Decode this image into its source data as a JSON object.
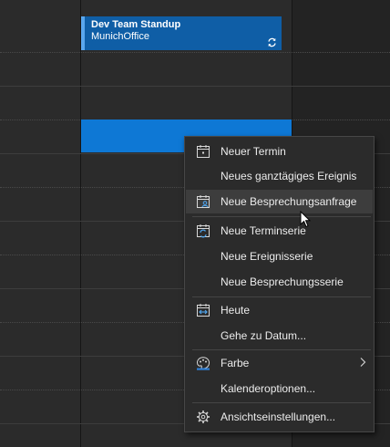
{
  "event": {
    "title": "Dev Team Standup",
    "location": "MunichOffice",
    "recurring_icon": "recurring-sync-icon",
    "color": "#0f5ea6"
  },
  "selection_color": "#0e78d5",
  "context_menu": {
    "items": [
      {
        "label": "Neuer Termin",
        "icon": "calendar-new-icon"
      },
      {
        "label": "Neues ganztägiges Ereignis",
        "icon": ""
      },
      {
        "label": "Neue Besprechungsanfrage",
        "icon": "meeting-request-icon"
      },
      {
        "label": "Neue Terminserie",
        "icon": "recurring-appointment-icon"
      },
      {
        "label": "Neue Ereignisserie",
        "icon": ""
      },
      {
        "label": "Neue Besprechungsserie",
        "icon": ""
      },
      {
        "label": "Heute",
        "icon": "today-icon"
      },
      {
        "label": "Gehe zu Datum...",
        "icon": ""
      },
      {
        "label": "Farbe",
        "icon": "color-palette-icon",
        "submenu": true
      },
      {
        "label": "Kalenderoptionen...",
        "icon": ""
      },
      {
        "label": "Ansichtseinstellungen...",
        "icon": "gear-icon"
      }
    ],
    "hovered_item": "Neue Besprechungsanfrage"
  }
}
